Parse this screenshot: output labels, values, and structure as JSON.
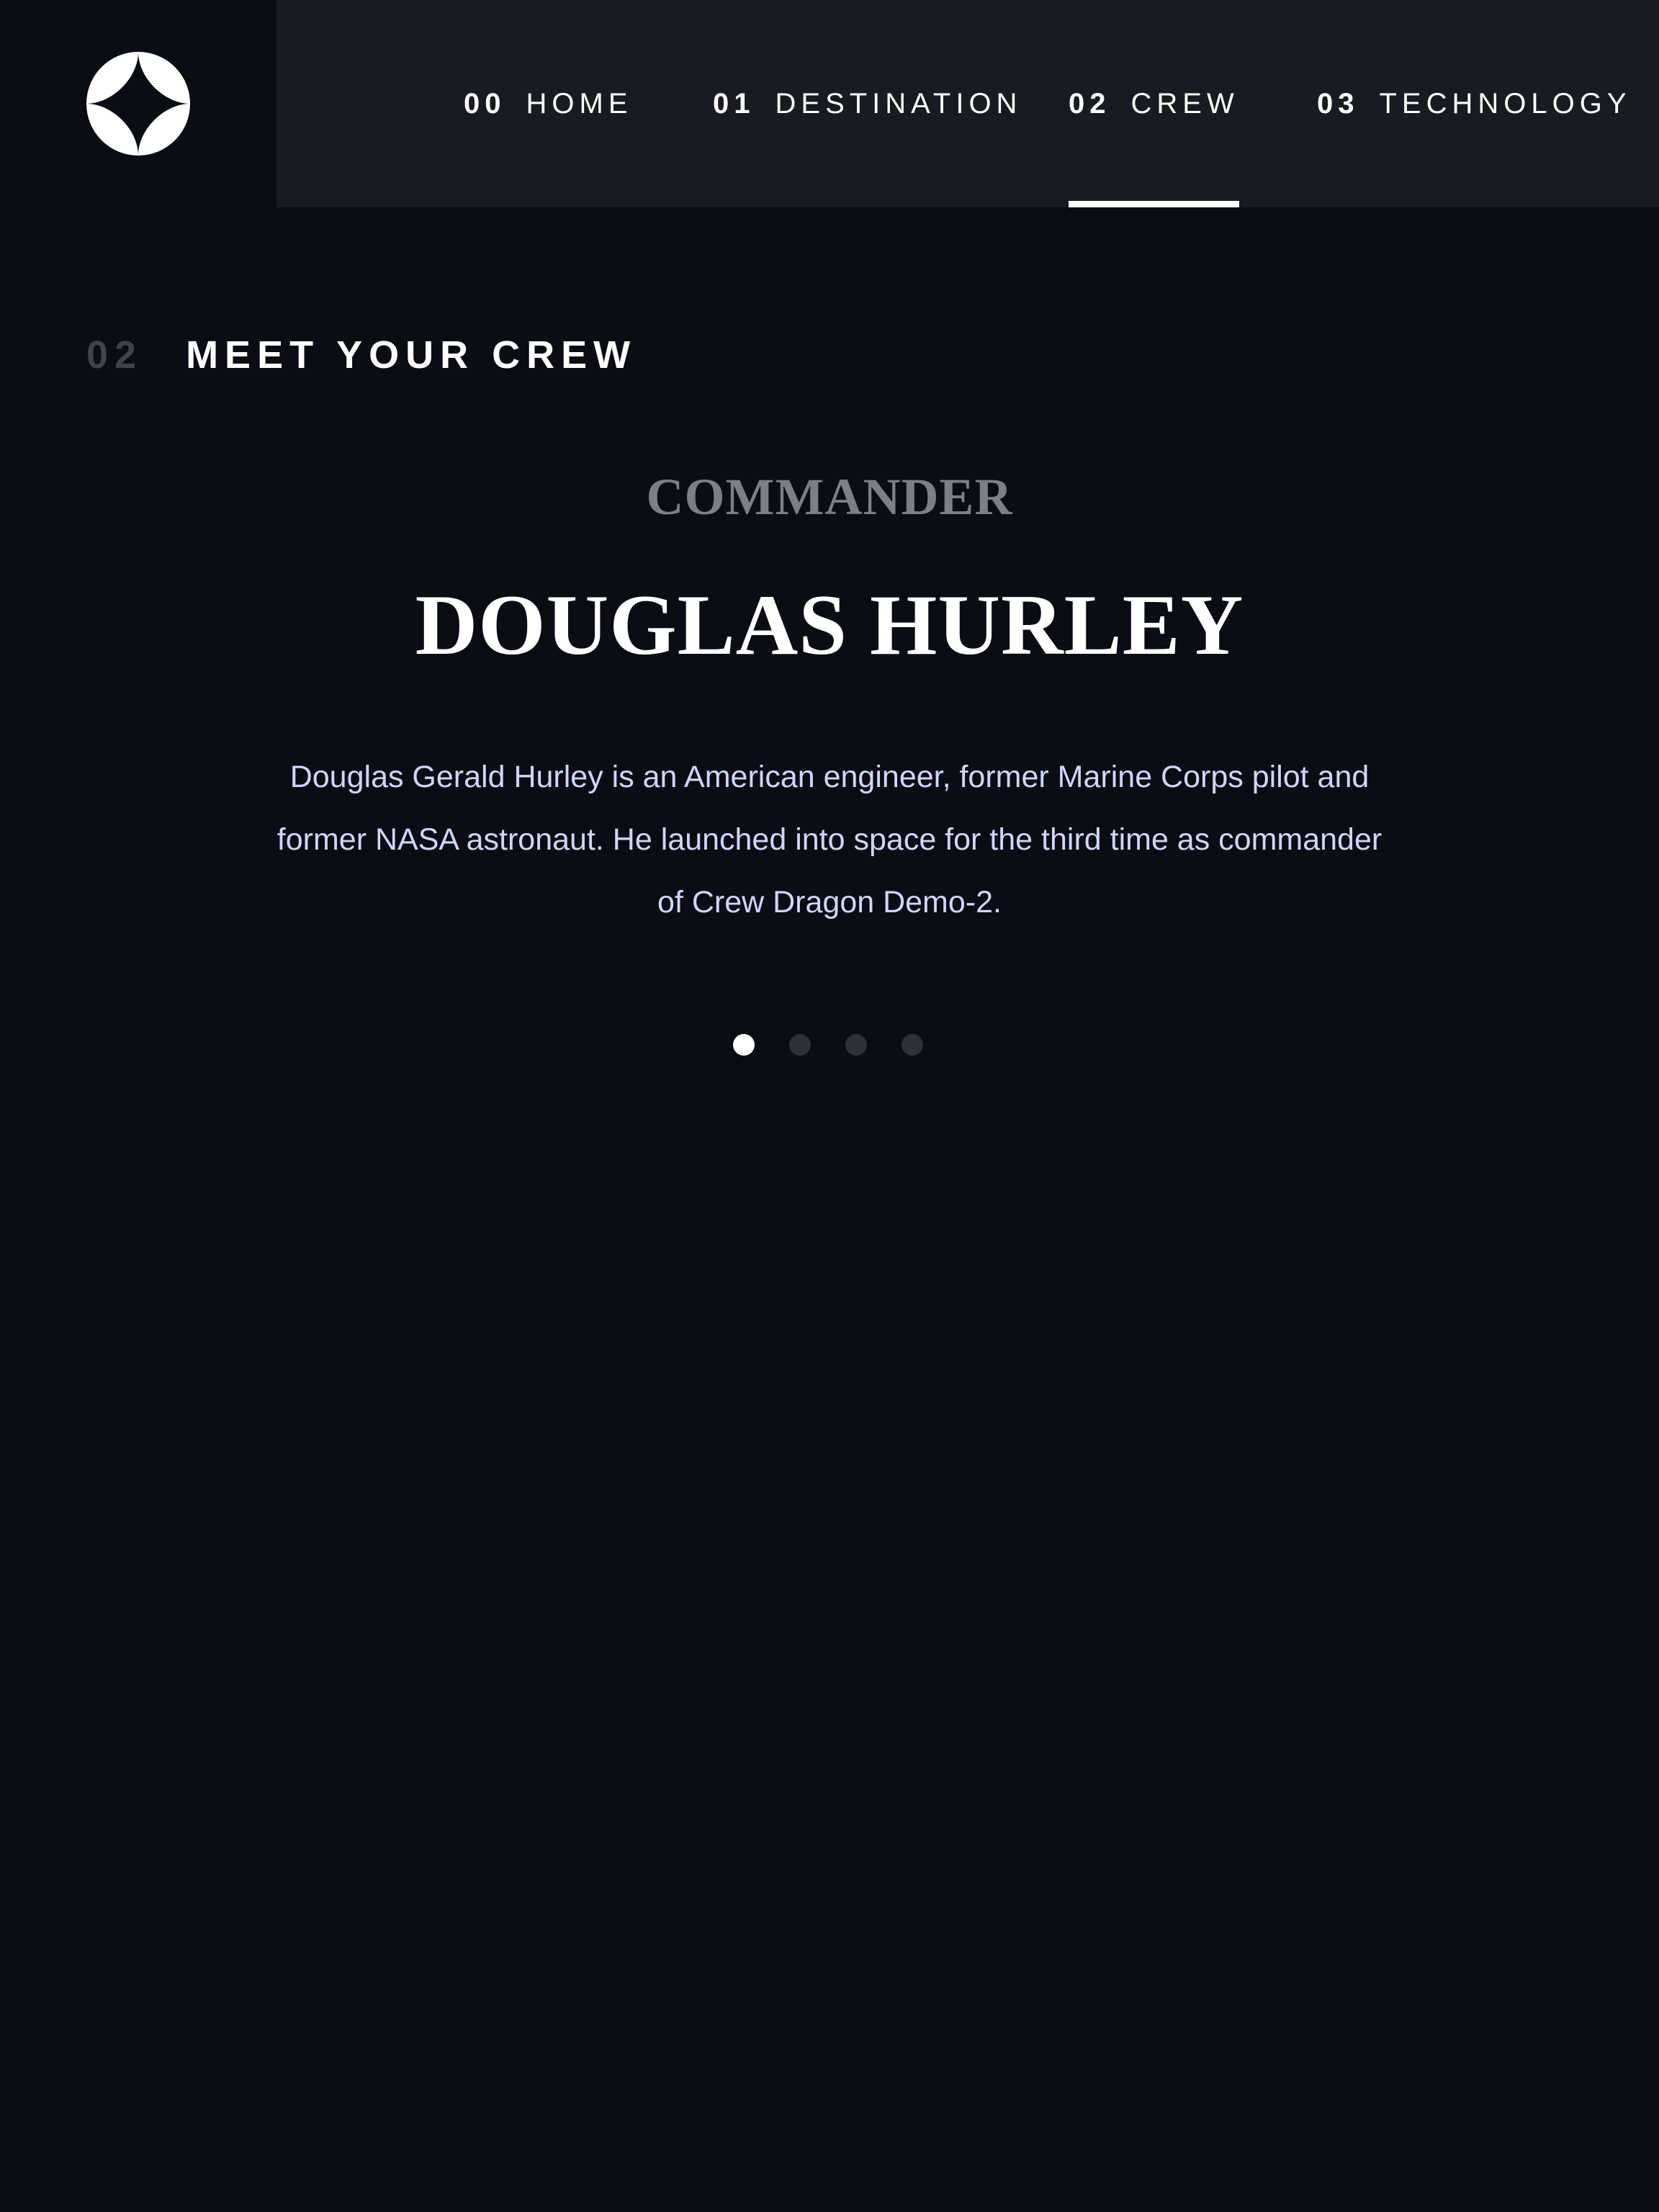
{
  "header": {
    "logo_icon": "star-logo-icon",
    "nav": [
      {
        "num": "00",
        "label": "HOME"
      },
      {
        "num": "01",
        "label": "DESTINATION"
      },
      {
        "num": "02",
        "label": "CREW",
        "active": true
      },
      {
        "num": "03",
        "label": "TECHNOLOGY"
      }
    ]
  },
  "section": {
    "num": "02",
    "title": "MEET YOUR CREW"
  },
  "crew": {
    "role": "COMMANDER",
    "name": "DOUGLAS HURLEY",
    "bio": "Douglas Gerald Hurley is an American engineer, former Marine Corps pilot and former NASA astronaut. He launched into space for the third time as commander of Crew Dragon Demo-2."
  },
  "slider": {
    "count": 4,
    "active_index": 0
  },
  "colors": {
    "background": "#0b0d15",
    "nav_background": "#191b23",
    "accent": "#ffffff",
    "muted_number": "#40434d",
    "role_text": "#7d7f86",
    "bio_text": "#d0d6f9",
    "inactive_dot": "#2f313a"
  }
}
